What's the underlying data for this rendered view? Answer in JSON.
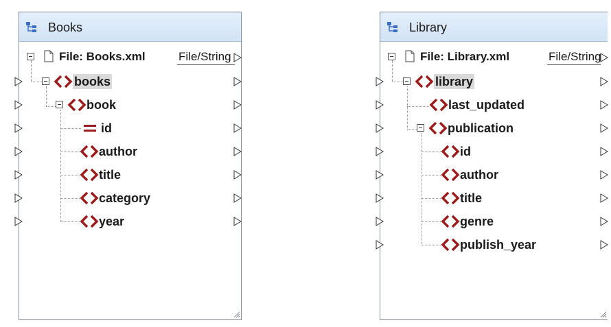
{
  "components": {
    "books": {
      "title": "Books",
      "file_label": "File: Books.xml",
      "file_button": "File/String",
      "nodes": [
        "books",
        "book",
        "id",
        "author",
        "title",
        "category",
        "year"
      ]
    },
    "library": {
      "title": "Library",
      "file_label": "File: Library.xml",
      "file_button": "File/String",
      "nodes": [
        "library",
        "last_updated",
        "publication",
        "id",
        "author",
        "title",
        "genre",
        "publish_year"
      ]
    }
  },
  "colors": {
    "element_icon": "#9b1c1c",
    "header_bg": "#d2e3f6",
    "border": "#7f8a99",
    "highlight": "#d9d9d9"
  },
  "icons": {
    "component": "tree-structure-icon",
    "file": "document-icon",
    "element": "angle-brackets-icon",
    "attribute": "equals-icon",
    "connector": "triangle-connector-icon"
  }
}
